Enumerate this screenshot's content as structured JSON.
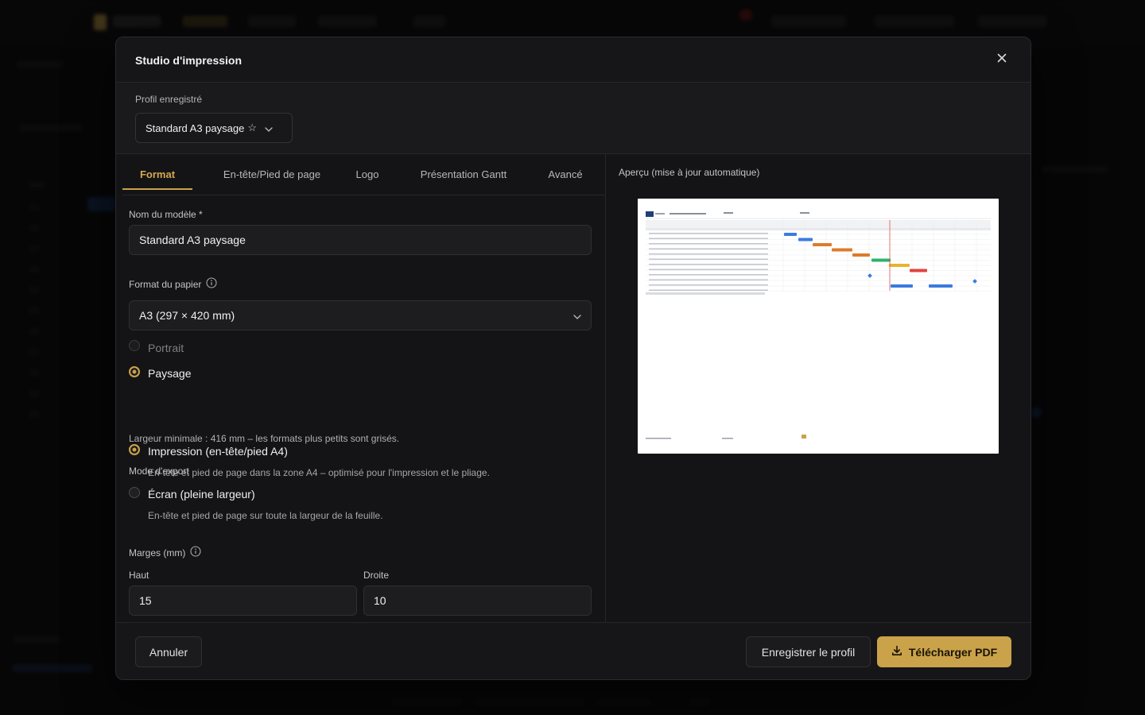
{
  "modal": {
    "title": "Studio d'impression",
    "profile": {
      "label": "Profil enregistré",
      "selected": "Standard A3 paysage"
    },
    "tabs": [
      {
        "label": "Format",
        "active": true
      },
      {
        "label": "En-tête/Pied de page",
        "active": false
      },
      {
        "label": "Logo",
        "active": false
      },
      {
        "label": "Présentation Gantt",
        "active": false
      },
      {
        "label": "Avancé",
        "active": false
      }
    ],
    "form": {
      "template_name_label": "Nom du modèle *",
      "template_name_value": "Standard A3 paysage",
      "paper_format_label": "Format du papier",
      "paper_format_value": "A3 (297 × 420 mm)",
      "orientation": {
        "portrait": "Portrait",
        "landscape": "Paysage",
        "selected": "landscape"
      },
      "min_width_note": "Largeur minimale : 416 mm – les formats plus petits sont grisés.",
      "export_mode_label": "Mode d'export",
      "export_modes": [
        {
          "label": "Impression (en-tête/pied A4)",
          "help": "En-tête et pied de page dans la zone A4 – optimisé pour l'impression et le pliage.",
          "selected": true
        },
        {
          "label": "Écran (pleine largeur)",
          "help": "En-tête et pied de page sur toute la largeur de la feuille.",
          "selected": false
        }
      ],
      "margins_label": "Marges (mm)",
      "margin_top_label": "Haut",
      "margin_top_value": "15",
      "margin_right_label": "Droite",
      "margin_right_value": "10"
    },
    "preview": {
      "label": "Aperçu (mise à jour automatique)"
    },
    "footer": {
      "cancel": "Annuler",
      "save_profile": "Enregistrer le profil",
      "download": "Télécharger PDF"
    }
  },
  "colors": {
    "accent": "#c9a24a",
    "modal_bg": "#141416",
    "border": "#27272b"
  },
  "icons": [
    "close-icon",
    "star-outline-icon",
    "chevron-down-icon",
    "info-icon",
    "download-icon"
  ]
}
